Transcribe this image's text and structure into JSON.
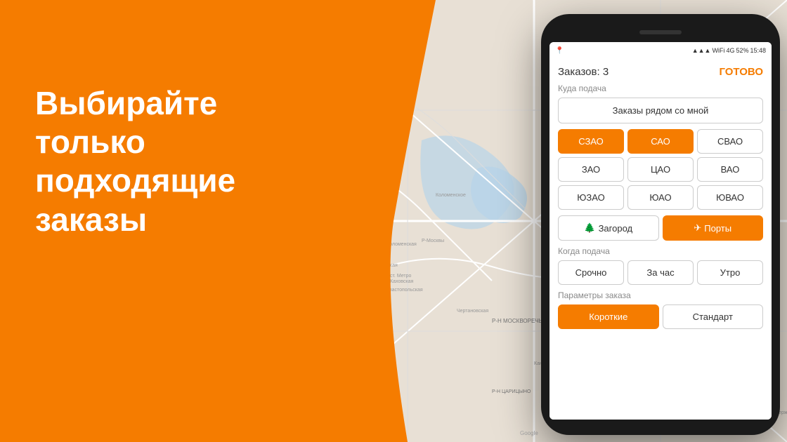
{
  "background": {
    "number": "5",
    "accent_color": "#F57C00"
  },
  "headline": {
    "line1": "Выбирайте только",
    "line2": "подходящие заказы"
  },
  "phone": {
    "status_bar": {
      "time": "15:48",
      "battery": "52%",
      "signal": "4G",
      "wifi": true,
      "location": true
    },
    "app": {
      "orders_count_label": "Заказов: 3",
      "done_label": "ГОТОВО",
      "where_section": "Куда подача",
      "nearby_btn": "Заказы рядом со мной",
      "districts": [
        {
          "label": "СЗАО",
          "active": true
        },
        {
          "label": "САО",
          "active": true
        },
        {
          "label": "СВАО",
          "active": false
        },
        {
          "label": "ЗАО",
          "active": false
        },
        {
          "label": "ЦАО",
          "active": false
        },
        {
          "label": "ВАО",
          "active": false
        },
        {
          "label": "ЮЗАО",
          "active": false
        },
        {
          "label": "ЮАО",
          "active": false
        },
        {
          "label": "ЮВАО",
          "active": false
        }
      ],
      "special_buttons": [
        {
          "label": "Загород",
          "icon": "🌲",
          "active": false
        },
        {
          "label": "Порты",
          "icon": "✈",
          "active": true
        }
      ],
      "when_section": "Когда подача",
      "time_buttons": [
        {
          "label": "Срочно",
          "active": false
        },
        {
          "label": "За час",
          "active": false
        },
        {
          "label": "Утро",
          "active": false
        }
      ],
      "params_section": "Параметры заказа",
      "params_buttons": [
        {
          "label": "Короткие",
          "active": true
        },
        {
          "label": "Стандарт",
          "active": false
        }
      ]
    }
  }
}
